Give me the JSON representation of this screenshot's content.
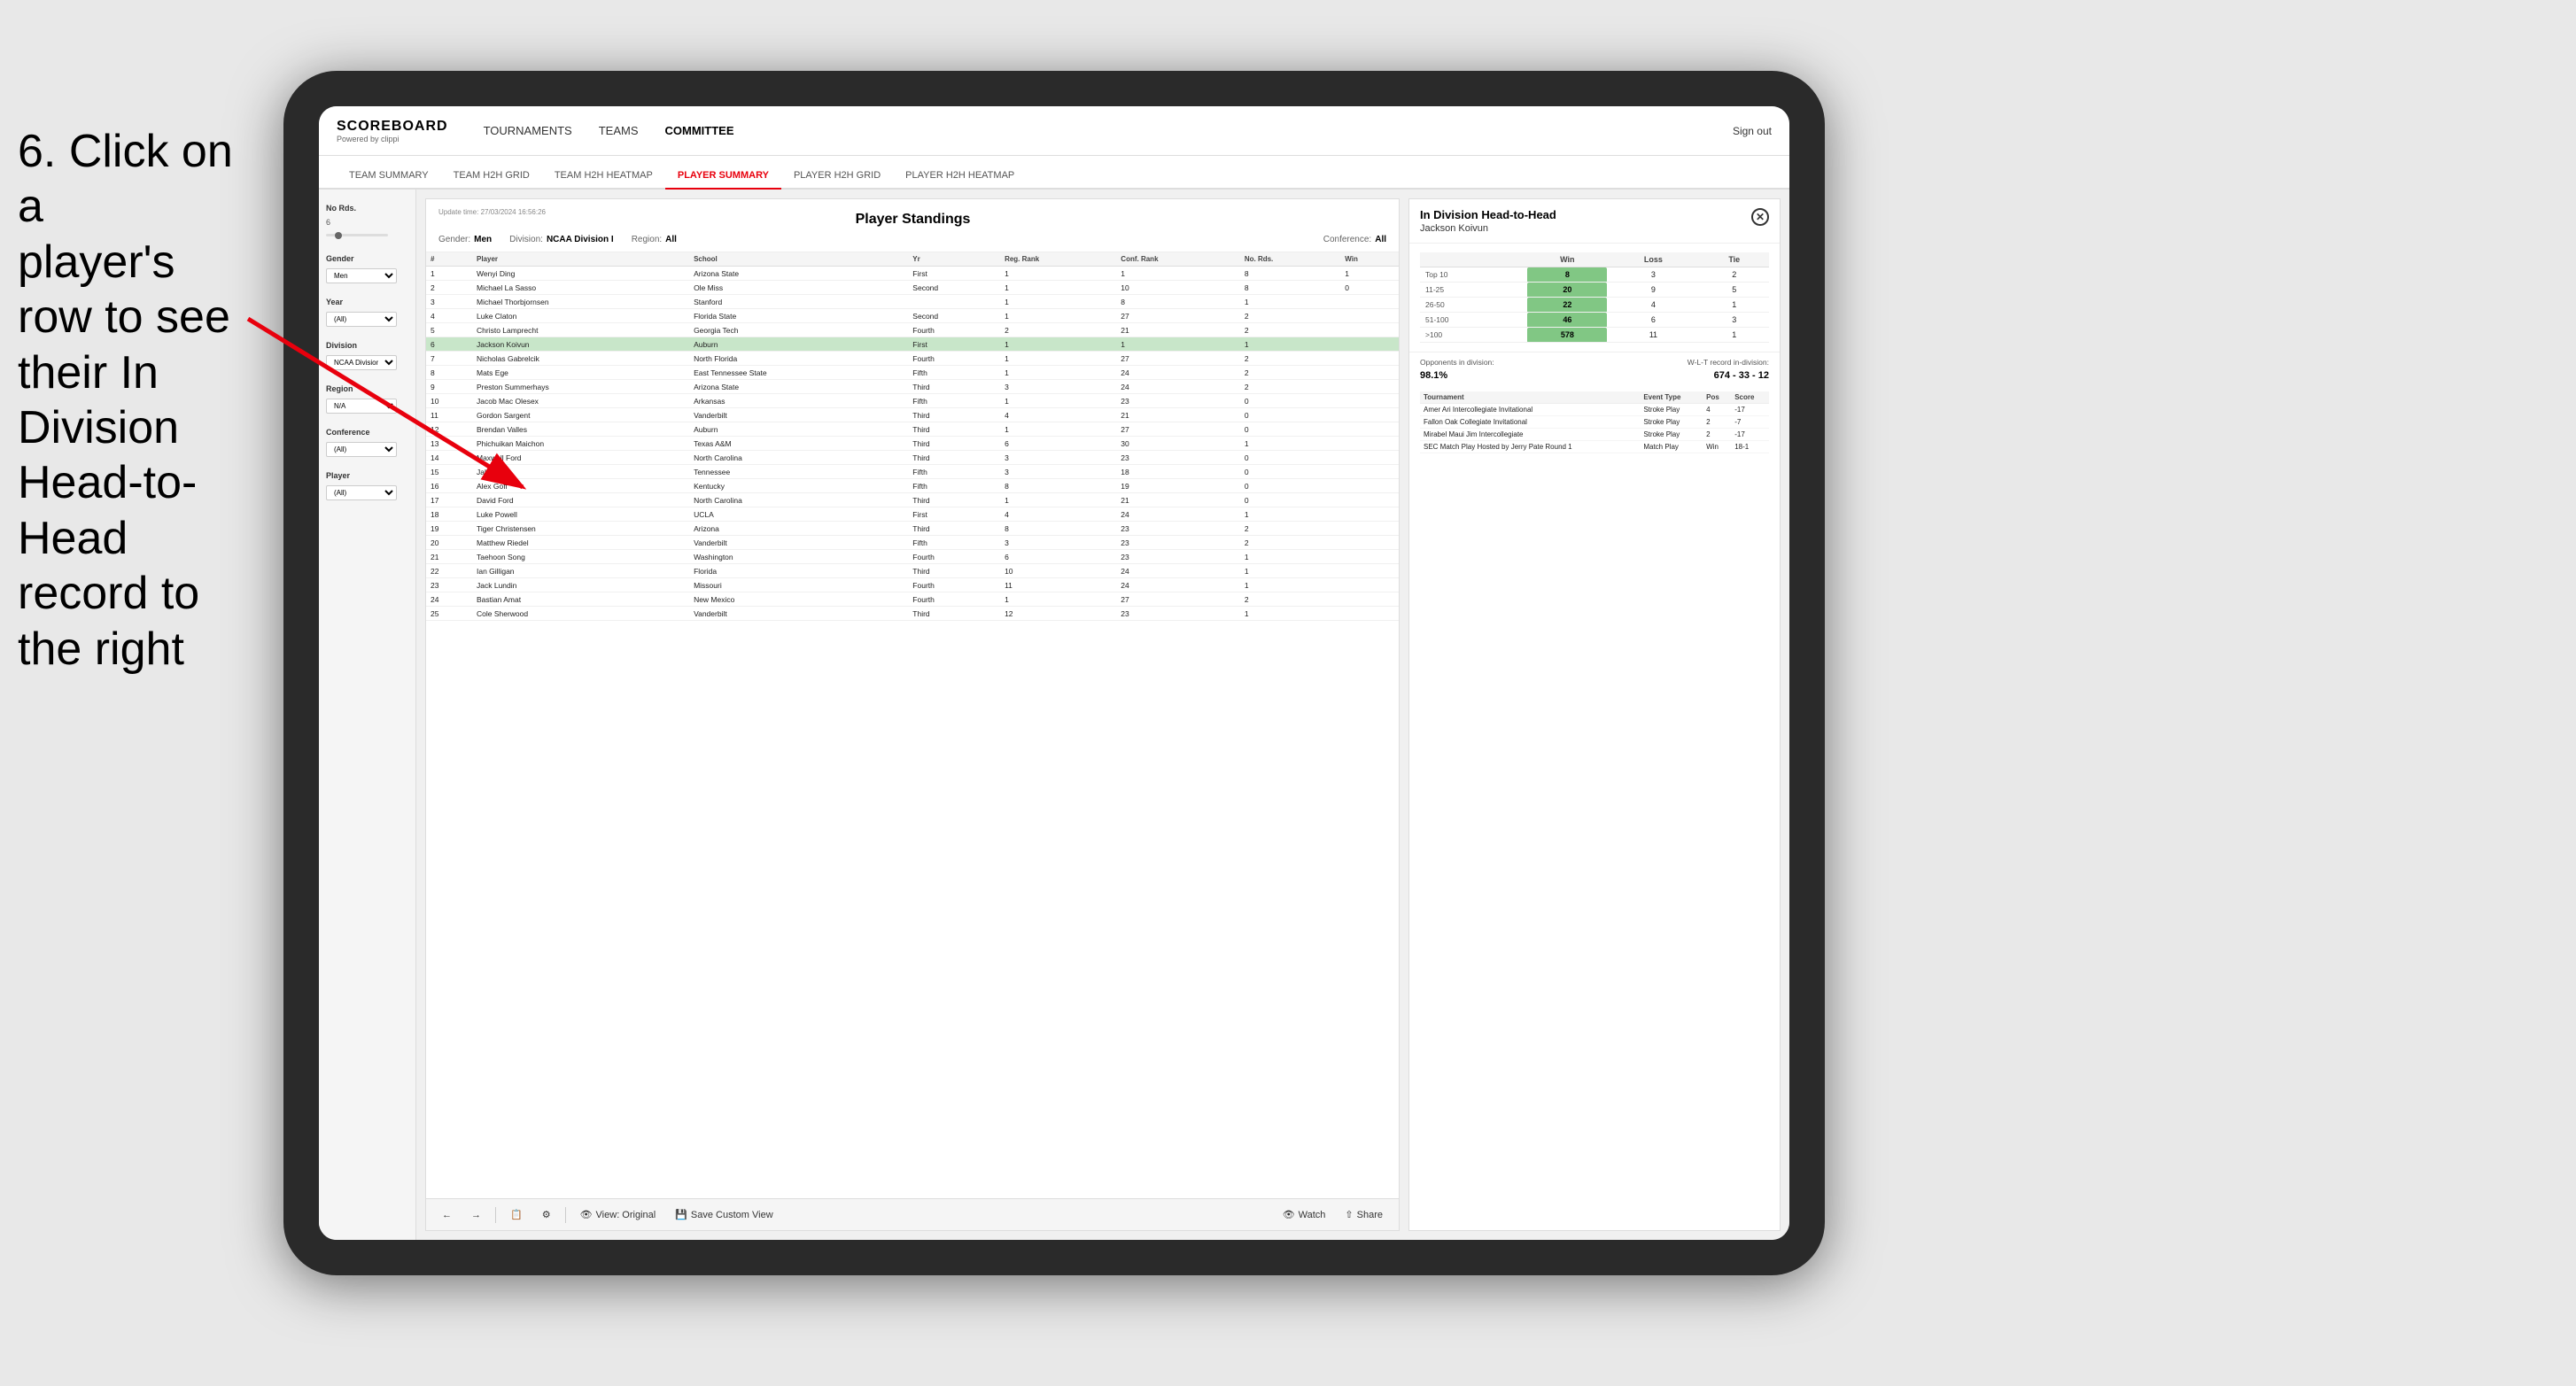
{
  "instruction": {
    "line1": "6. Click on a",
    "line2": "player's row to see",
    "line3": "their In Division",
    "line4": "Head-to-Head",
    "line5": "record to the right"
  },
  "app": {
    "logo": "SCOREBOARD",
    "powered_by": "Powered by clippi",
    "sign_out": "Sign out"
  },
  "nav": {
    "items": [
      "TOURNAMENTS",
      "TEAMS",
      "COMMITTEE"
    ],
    "active": "COMMITTEE"
  },
  "sub_nav": {
    "items": [
      "TEAM SUMMARY",
      "TEAM H2H GRID",
      "TEAM H2H HEATMAP",
      "PLAYER SUMMARY",
      "PLAYER H2H GRID",
      "PLAYER H2H HEATMAP"
    ],
    "active": "PLAYER SUMMARY"
  },
  "sidebar": {
    "no_rds_label": "No Rds.",
    "no_rds_value": "6",
    "gender_label": "Gender",
    "gender_value": "Men",
    "year_label": "Year",
    "year_value": "(All)",
    "division_label": "Division",
    "division_value": "NCAA Division I",
    "region_label": "Region",
    "region_value": "N/A",
    "conference_label": "Conference",
    "conference_value": "(All)",
    "player_label": "Player",
    "player_value": "(All)"
  },
  "panel": {
    "update_time_label": "Update time:",
    "update_time": "27/03/2024 16:56:26",
    "title": "Player Standings",
    "gender_label": "Gender:",
    "gender": "Men",
    "division_label": "Division:",
    "division": "NCAA Division I",
    "region_label": "Region:",
    "region": "All",
    "conference_label": "Conference:",
    "conference": "All"
  },
  "table": {
    "headers": [
      "#",
      "Player",
      "School",
      "Yr",
      "Reg. Rank",
      "Conf. Rank",
      "No. Rds.",
      "Win"
    ],
    "rows": [
      {
        "num": "1",
        "player": "Wenyi Ding",
        "school": "Arizona State",
        "yr": "First",
        "reg": "1",
        "conf": "1",
        "no_rds": "8",
        "win": "1"
      },
      {
        "num": "2",
        "player": "Michael La Sasso",
        "school": "Ole Miss",
        "yr": "Second",
        "reg": "1",
        "conf": "10",
        "no_rds": "8",
        "win": "0"
      },
      {
        "num": "3",
        "player": "Michael Thorbjornsen",
        "school": "Stanford",
        "yr": "",
        "reg": "1",
        "conf": "8",
        "no_rds": "1",
        "win": ""
      },
      {
        "num": "4",
        "player": "Luke Claton",
        "school": "Florida State",
        "yr": "Second",
        "reg": "1",
        "conf": "27",
        "no_rds": "2",
        "win": ""
      },
      {
        "num": "5",
        "player": "Christo Lamprecht",
        "school": "Georgia Tech",
        "yr": "Fourth",
        "reg": "2",
        "conf": "21",
        "no_rds": "2",
        "win": ""
      },
      {
        "num": "6",
        "player": "Jackson Koivun",
        "school": "Auburn",
        "yr": "First",
        "reg": "1",
        "conf": "1",
        "no_rds": "1",
        "win": "",
        "selected": true
      },
      {
        "num": "7",
        "player": "Nicholas Gabrelcik",
        "school": "North Florida",
        "yr": "Fourth",
        "reg": "1",
        "conf": "27",
        "no_rds": "2",
        "win": ""
      },
      {
        "num": "8",
        "player": "Mats Ege",
        "school": "East Tennessee State",
        "yr": "Fifth",
        "reg": "1",
        "conf": "24",
        "no_rds": "2",
        "win": ""
      },
      {
        "num": "9",
        "player": "Preston Summerhays",
        "school": "Arizona State",
        "yr": "Third",
        "reg": "3",
        "conf": "24",
        "no_rds": "2",
        "win": ""
      },
      {
        "num": "10",
        "player": "Jacob Mac Olesex",
        "school": "Arkansas",
        "yr": "Fifth",
        "reg": "1",
        "conf": "23",
        "no_rds": "0",
        "win": ""
      },
      {
        "num": "11",
        "player": "Gordon Sargent",
        "school": "Vanderbilt",
        "yr": "Third",
        "reg": "4",
        "conf": "21",
        "no_rds": "0",
        "win": ""
      },
      {
        "num": "12",
        "player": "Brendan Valles",
        "school": "Auburn",
        "yr": "Third",
        "reg": "1",
        "conf": "27",
        "no_rds": "0",
        "win": ""
      },
      {
        "num": "13",
        "player": "Phichuikan Maichon",
        "school": "Texas A&M",
        "yr": "Third",
        "reg": "6",
        "conf": "30",
        "no_rds": "1",
        "win": ""
      },
      {
        "num": "14",
        "player": "Maxwell Ford",
        "school": "North Carolina",
        "yr": "Third",
        "reg": "3",
        "conf": "23",
        "no_rds": "0",
        "win": ""
      },
      {
        "num": "15",
        "player": "Jake Hall",
        "school": "Tennessee",
        "yr": "Fifth",
        "reg": "3",
        "conf": "18",
        "no_rds": "0",
        "win": ""
      },
      {
        "num": "16",
        "player": "Alex Goff",
        "school": "Kentucky",
        "yr": "Fifth",
        "reg": "8",
        "conf": "19",
        "no_rds": "0",
        "win": ""
      },
      {
        "num": "17",
        "player": "David Ford",
        "school": "North Carolina",
        "yr": "Third",
        "reg": "1",
        "conf": "21",
        "no_rds": "0",
        "win": ""
      },
      {
        "num": "18",
        "player": "Luke Powell",
        "school": "UCLA",
        "yr": "First",
        "reg": "4",
        "conf": "24",
        "no_rds": "1",
        "win": ""
      },
      {
        "num": "19",
        "player": "Tiger Christensen",
        "school": "Arizona",
        "yr": "Third",
        "reg": "8",
        "conf": "23",
        "no_rds": "2",
        "win": ""
      },
      {
        "num": "20",
        "player": "Matthew Riedel",
        "school": "Vanderbilt",
        "yr": "Fifth",
        "reg": "3",
        "conf": "23",
        "no_rds": "2",
        "win": ""
      },
      {
        "num": "21",
        "player": "Taehoon Song",
        "school": "Washington",
        "yr": "Fourth",
        "reg": "6",
        "conf": "23",
        "no_rds": "1",
        "win": ""
      },
      {
        "num": "22",
        "player": "Ian Gilligan",
        "school": "Florida",
        "yr": "Third",
        "reg": "10",
        "conf": "24",
        "no_rds": "1",
        "win": ""
      },
      {
        "num": "23",
        "player": "Jack Lundin",
        "school": "Missouri",
        "yr": "Fourth",
        "reg": "11",
        "conf": "24",
        "no_rds": "1",
        "win": ""
      },
      {
        "num": "24",
        "player": "Bastian Amat",
        "school": "New Mexico",
        "yr": "Fourth",
        "reg": "1",
        "conf": "27",
        "no_rds": "2",
        "win": ""
      },
      {
        "num": "25",
        "player": "Cole Sherwood",
        "school": "Vanderbilt",
        "yr": "Third",
        "reg": "12",
        "conf": "23",
        "no_rds": "1",
        "win": ""
      }
    ]
  },
  "h2h": {
    "title": "In Division Head-to-Head",
    "player": "Jackson Koivun",
    "win_label": "Win",
    "loss_label": "Loss",
    "tie_label": "Tie",
    "rows": [
      {
        "range": "Top 10",
        "win": "8",
        "loss": "3",
        "tie": "2"
      },
      {
        "range": "11-25",
        "win": "20",
        "loss": "9",
        "tie": "5"
      },
      {
        "range": "26-50",
        "win": "22",
        "loss": "4",
        "tie": "1"
      },
      {
        "range": "51-100",
        "win": "46",
        "loss": "6",
        "tie": "3"
      },
      {
        "range": ">100",
        "win": "578",
        "loss": "11",
        "tie": "1"
      }
    ],
    "opponents_label": "Opponents in division:",
    "wl_label": "W-L-T record in-division:",
    "opponents_pct": "98.1%",
    "wl_record": "674 - 33 - 12",
    "tournament_headers": [
      "Tournament",
      "Event Type",
      "Pos",
      "Score"
    ],
    "tournaments": [
      {
        "name": "Amer Ari Intercollegiate Invitational",
        "type": "Stroke Play",
        "pos": "4",
        "score": "-17"
      },
      {
        "name": "Fallon Oak Collegiate Invitational",
        "type": "Stroke Play",
        "pos": "2",
        "score": "-7"
      },
      {
        "name": "Mirabel Maui Jim Intercollegiate",
        "type": "Stroke Play",
        "pos": "2",
        "score": "-17"
      },
      {
        "name": "SEC Match Play Hosted by Jerry Pate Round 1",
        "type": "Match Play",
        "pos": "Win",
        "score": "18-1"
      }
    ]
  },
  "toolbar": {
    "view_original": "View: Original",
    "save_custom": "Save Custom View",
    "watch": "Watch",
    "share": "Share"
  }
}
